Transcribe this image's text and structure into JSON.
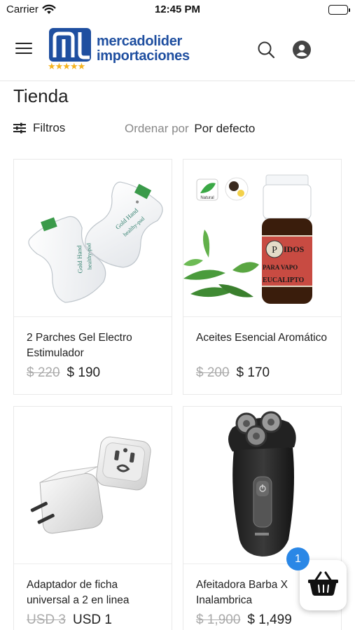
{
  "status_bar": {
    "carrier": "Carrier",
    "time": "12:45 PM"
  },
  "header": {
    "logo_text_line1": "mercadolider",
    "logo_text_line2": "importaciones",
    "logo_stars": "★★★★★",
    "logo_color": "#1f4fa0",
    "star_color": "#f5b21c",
    "icons": [
      "menu-icon",
      "search-icon",
      "user-icon"
    ]
  },
  "page": {
    "title": "Tienda"
  },
  "filters": {
    "label": "Filtros",
    "sort_label": "Ordenar por",
    "sort_value": "Por defecto"
  },
  "products": [
    {
      "name": "2 Parches Gel Electro Estimulador",
      "price_old": "$ 220",
      "price_new": "$ 190"
    },
    {
      "name": "Aceites Esencial Aromático",
      "price_old": "$ 200",
      "price_new": "$ 170"
    },
    {
      "name": "Adaptador de ficha universal a 2 en linea",
      "price_old": "USD 3",
      "price_new": "USD 1"
    },
    {
      "name": "Afeitadora Barba X Inalambrica",
      "price_old": "$ 1,900",
      "price_new": "$ 1,499"
    }
  ],
  "product_image_text": {
    "patch_brand": "Gold Hand",
    "patch_brand_sub": "healthy-pad",
    "oil_badge": "Natural",
    "oil_label_top": "IDOS",
    "oil_label_mid": "PARA VAPO",
    "oil_label_bottom": "EUCALIPTO"
  },
  "cart": {
    "count": "1",
    "badge_color": "#2a87e6"
  }
}
